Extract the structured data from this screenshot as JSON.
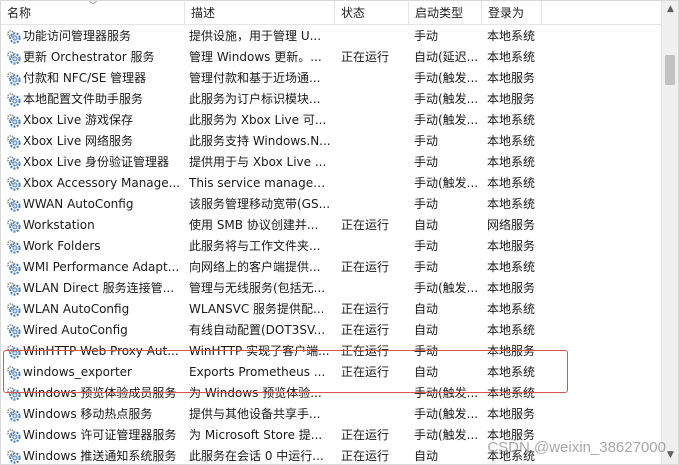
{
  "columns": {
    "name": "名称",
    "description": "描述",
    "status": "状态",
    "startup": "启动类型",
    "logon": "登录为"
  },
  "services": [
    {
      "name": "功能访问管理器服务",
      "description": "提供设施，用于管理 U...",
      "status": "",
      "startup": "手动",
      "logon": "本地系统"
    },
    {
      "name": "更新 Orchestrator 服务",
      "description": "管理 Windows 更新。...",
      "status": "正在运行",
      "startup": "自动(延迟...",
      "logon": "本地系统"
    },
    {
      "name": "付款和 NFC/SE 管理器",
      "description": "管理付款和基于近场通...",
      "status": "",
      "startup": "手动(触发...",
      "logon": "本地服务"
    },
    {
      "name": "本地配置文件助手服务",
      "description": "此服务为订户标识模块...",
      "status": "",
      "startup": "手动(触发...",
      "logon": "本地服务"
    },
    {
      "name": "Xbox Live 游戏保存",
      "description": "此服务为 Xbox Live 可...",
      "status": "",
      "startup": "手动(触发...",
      "logon": "本地系统"
    },
    {
      "name": "Xbox Live 网络服务",
      "description": "此服务支持 Windows.N...",
      "status": "",
      "startup": "手动",
      "logon": "本地系统"
    },
    {
      "name": "Xbox Live 身份验证管理器",
      "description": "提供用于与 Xbox Live ...",
      "status": "",
      "startup": "手动",
      "logon": "本地系统"
    },
    {
      "name": "Xbox Accessory Manage...",
      "description": "This service manages ...",
      "status": "",
      "startup": "手动(触发...",
      "logon": "本地系统"
    },
    {
      "name": "WWAN AutoConfig",
      "description": "该服务管理移动宽带(GS...",
      "status": "",
      "startup": "手动",
      "logon": "本地系统"
    },
    {
      "name": "Workstation",
      "description": "使用 SMB 协议创建并...",
      "status": "正在运行",
      "startup": "自动",
      "logon": "网络服务"
    },
    {
      "name": "Work Folders",
      "description": "此服务将与工作文件夹...",
      "status": "",
      "startup": "手动",
      "logon": "本地服务"
    },
    {
      "name": "WMI Performance Adapt...",
      "description": "向网络上的客户端提供...",
      "status": "正在运行",
      "startup": "手动",
      "logon": "本地系统"
    },
    {
      "name": "WLAN Direct 服务连接管...",
      "description": "管理与无线服务(包括无...",
      "status": "",
      "startup": "手动(触发...",
      "logon": "本地服务"
    },
    {
      "name": "WLAN AutoConfig",
      "description": "WLANSVC 服务提供配...",
      "status": "正在运行",
      "startup": "自动",
      "logon": "本地系统"
    },
    {
      "name": "Wired AutoConfig",
      "description": "有线自动配置(DOT3SV...",
      "status": "正在运行",
      "startup": "自动",
      "logon": "本地系统"
    },
    {
      "name": "WinHTTP Web Proxy Aut...",
      "description": "WinHTTP 实现了客户端...",
      "status": "正在运行",
      "startup": "手动",
      "logon": "本地服务"
    },
    {
      "name": "windows_exporter",
      "description": "Exports Prometheus ...",
      "status": "正在运行",
      "startup": "自动",
      "logon": "本地系统"
    },
    {
      "name": "Windows 预览体验成员服务",
      "description": "为 Windows 预览体验...",
      "status": "",
      "startup": "手动(触发...",
      "logon": "本地系统"
    },
    {
      "name": "Windows 移动热点服务",
      "description": "提供与其他设备共享手...",
      "status": "",
      "startup": "手动(触发...",
      "logon": "本地服务"
    },
    {
      "name": "Windows 许可证管理器服务",
      "description": "为 Microsoft Store 提...",
      "status": "正在运行",
      "startup": "手动(触发...",
      "logon": "本地服务"
    },
    {
      "name": "Windows 推送通知系统服务",
      "description": "此服务在会话 0 中运行...",
      "status": "正在运行",
      "startup": "自动",
      "logon": "本地系统"
    }
  ],
  "watermark": "CSDN @weixin_38627000",
  "colors": {
    "highlight_border": "#d9534f",
    "gear_blue": "#4a7fb5",
    "gear_gray": "#8a8a8a"
  },
  "icons": {
    "service": "gear-icon",
    "sort": "sort-chevron-icon"
  }
}
